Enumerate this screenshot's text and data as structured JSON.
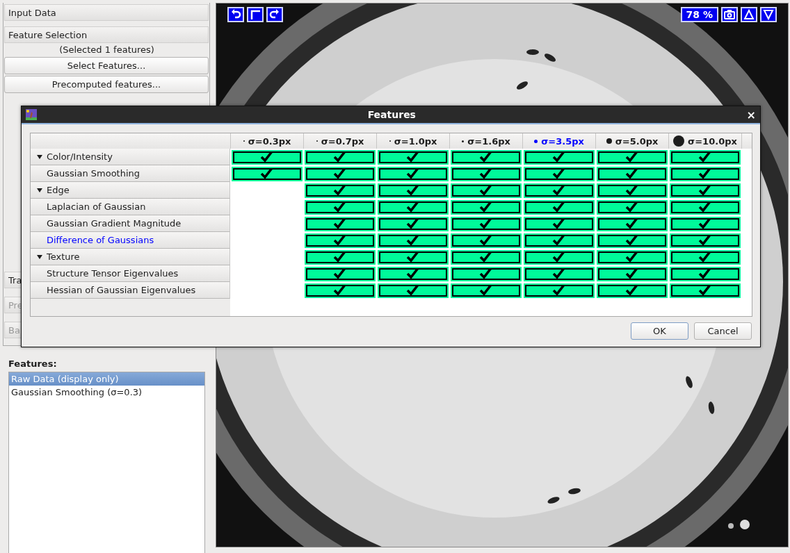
{
  "left_panel": {
    "sections": [
      {
        "label": "Input Data"
      },
      {
        "label": "Feature Selection"
      }
    ],
    "selected_count": "(Selected 1 features)",
    "buttons": [
      {
        "label": "Select Features..."
      },
      {
        "label": "Precomputed features..."
      }
    ],
    "lower_sections": [
      {
        "label": "Tra",
        "disabled": false
      },
      {
        "label": "Pre",
        "disabled": true
      },
      {
        "label": "Ba",
        "disabled": true
      }
    ],
    "features_title": "Features:",
    "features": [
      {
        "label": "Raw Data (display only)",
        "selected": true
      },
      {
        "label": "Gaussian Smoothing (σ=0.3)",
        "selected": false
      }
    ]
  },
  "viewer": {
    "left_tools": [
      {
        "kind": "undo"
      },
      {
        "kind": "corner"
      },
      {
        "kind": "redo"
      }
    ],
    "zoom": "78 %",
    "right_tools": [
      {
        "kind": "camera"
      },
      {
        "kind": "up"
      },
      {
        "kind": "down"
      }
    ]
  },
  "dialog": {
    "title": "Features",
    "close": "×",
    "columns": [
      {
        "label": "σ=0.3px",
        "selected": false
      },
      {
        "label": "σ=0.7px",
        "selected": false
      },
      {
        "label": "σ=1.0px",
        "selected": false
      },
      {
        "label": "σ=1.6px",
        "selected": false
      },
      {
        "label": "σ=3.5px",
        "selected": true
      },
      {
        "label": "σ=5.0px",
        "selected": false
      },
      {
        "label": "σ=10.0px",
        "selected": false
      }
    ],
    "groups": [
      {
        "label": "Color/Intensity",
        "expanded": true,
        "cells": [
          {
            "kind": "check",
            "checked": true
          },
          {
            "kind": "check",
            "checked": true
          },
          {
            "kind": "check",
            "checked": true
          },
          {
            "kind": "check",
            "checked": true
          },
          {
            "kind": "check",
            "checked": true
          },
          {
            "kind": "check",
            "checked": true
          },
          {
            "kind": "check",
            "checked": true
          }
        ],
        "children": [
          {
            "label": "Gaussian Smoothing",
            "selected": false,
            "cells": [
              {
                "kind": "check",
                "checked": true
              },
              {
                "kind": "check",
                "checked": true
              },
              {
                "kind": "check",
                "checked": true
              },
              {
                "kind": "check",
                "checked": true
              },
              {
                "kind": "check",
                "checked": true
              },
              {
                "kind": "check",
                "checked": true
              },
              {
                "kind": "check",
                "checked": true
              }
            ]
          }
        ]
      },
      {
        "label": "Edge",
        "expanded": true,
        "cells": [
          {
            "kind": "none"
          },
          {
            "kind": "check",
            "checked": true
          },
          {
            "kind": "check",
            "checked": true
          },
          {
            "kind": "check",
            "checked": true
          },
          {
            "kind": "check",
            "checked": true
          },
          {
            "kind": "check",
            "checked": true
          },
          {
            "kind": "check",
            "checked": true
          }
        ],
        "children": [
          {
            "label": "Laplacian of Gaussian",
            "selected": false,
            "cells": [
              {
                "kind": "none"
              },
              {
                "kind": "check",
                "checked": true
              },
              {
                "kind": "check",
                "checked": true
              },
              {
                "kind": "check",
                "checked": true
              },
              {
                "kind": "check",
                "checked": true
              },
              {
                "kind": "check",
                "checked": true
              },
              {
                "kind": "check",
                "checked": true
              }
            ]
          },
          {
            "label": "Gaussian Gradient Magnitude",
            "selected": false,
            "cells": [
              {
                "kind": "none"
              },
              {
                "kind": "check",
                "checked": true
              },
              {
                "kind": "check",
                "checked": true
              },
              {
                "kind": "check",
                "checked": true
              },
              {
                "kind": "check",
                "checked": true
              },
              {
                "kind": "check",
                "checked": true
              },
              {
                "kind": "check",
                "checked": true
              }
            ]
          },
          {
            "label": "Difference of Gaussians",
            "selected": true,
            "cells": [
              {
                "kind": "none"
              },
              {
                "kind": "check",
                "checked": true
              },
              {
                "kind": "check",
                "checked": true
              },
              {
                "kind": "check",
                "checked": true
              },
              {
                "kind": "check",
                "checked": true
              },
              {
                "kind": "check",
                "checked": true
              },
              {
                "kind": "check",
                "checked": true
              }
            ]
          }
        ]
      },
      {
        "label": "Texture",
        "expanded": true,
        "cells": [
          {
            "kind": "none"
          },
          {
            "kind": "check",
            "checked": true
          },
          {
            "kind": "check",
            "checked": true
          },
          {
            "kind": "check",
            "checked": true
          },
          {
            "kind": "check",
            "checked": true
          },
          {
            "kind": "check",
            "checked": true
          },
          {
            "kind": "check",
            "checked": true
          }
        ],
        "children": [
          {
            "label": "Structure Tensor Eigenvalues",
            "selected": false,
            "cells": [
              {
                "kind": "none"
              },
              {
                "kind": "check",
                "checked": true
              },
              {
                "kind": "check",
                "checked": true
              },
              {
                "kind": "check",
                "checked": true
              },
              {
                "kind": "check",
                "checked": true
              },
              {
                "kind": "check",
                "checked": true
              },
              {
                "kind": "check",
                "checked": true
              }
            ]
          },
          {
            "label": "Hessian of Gaussian Eigenvalues",
            "selected": false,
            "cells": [
              {
                "kind": "none"
              },
              {
                "kind": "check",
                "checked": true
              },
              {
                "kind": "check",
                "checked": true
              },
              {
                "kind": "check",
                "checked": true
              },
              {
                "kind": "check",
                "checked": true
              },
              {
                "kind": "check",
                "checked": true
              },
              {
                "kind": "check",
                "checked": true
              }
            ]
          }
        ]
      }
    ],
    "buttons": [
      {
        "label": "OK",
        "default": true
      },
      {
        "label": "Cancel",
        "default": false
      }
    ]
  }
}
